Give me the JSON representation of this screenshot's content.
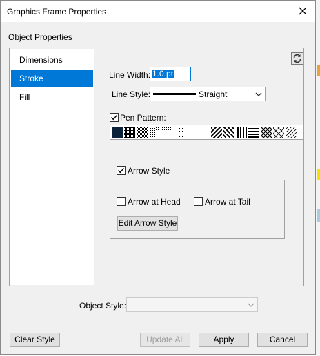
{
  "dialog": {
    "title": "Graphics Frame Properties",
    "close_label": "✕",
    "section_label": "Object Properties"
  },
  "tabs": [
    {
      "label": "Dimensions",
      "active": false
    },
    {
      "label": "Stroke",
      "active": true
    },
    {
      "label": "Fill",
      "active": false
    }
  ],
  "stroke": {
    "line_width_label": "Line Width:",
    "line_width_value": "1.0 pt",
    "line_style_label": "Line Style:",
    "line_style_value": "Straight",
    "pen_pattern_label": "Pen Pattern:",
    "pen_pattern_checked": true,
    "arrow_style_label": "Arrow Style",
    "arrow_style_checked": true,
    "arrow_head_label": "Arrow at Head",
    "arrow_head_checked": false,
    "arrow_tail_label": "Arrow at Tail",
    "arrow_tail_checked": false,
    "edit_arrow_label": "Edit Arrow Style"
  },
  "footer": {
    "object_style_label": "Object Style:",
    "object_style_value": "",
    "clear_style_label": "Clear Style",
    "update_all_label": "Update All",
    "apply_label": "Apply",
    "cancel_label": "Cancel"
  },
  "colors": {
    "accent": "#0078d7",
    "selected_swatch": "#0b2238"
  }
}
